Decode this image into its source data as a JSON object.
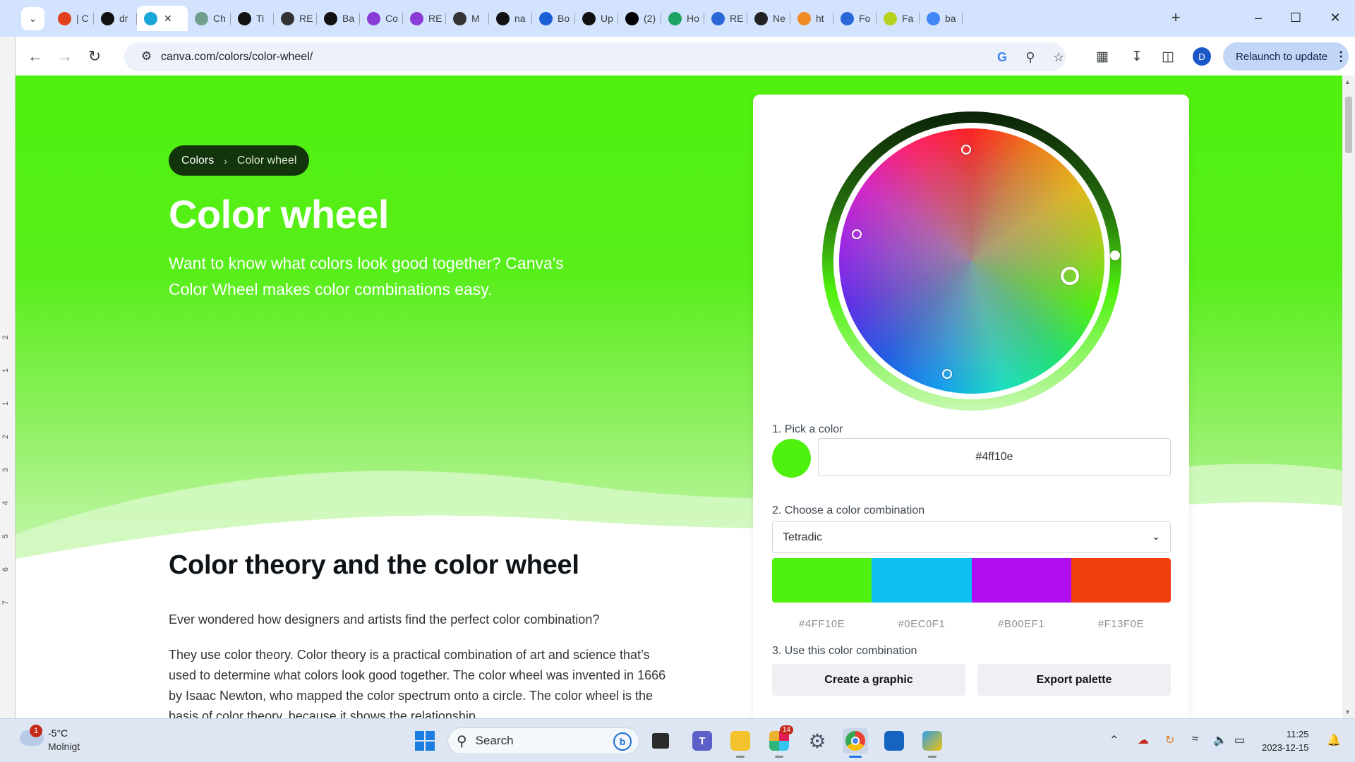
{
  "browser": {
    "tabs": [
      {
        "label": "| C",
        "icon": "opera-icon",
        "color": "#e0401a"
      },
      {
        "label": "dr",
        "icon": "github-icon",
        "color": "#111111"
      },
      {
        "label": "",
        "icon": "canva-icon",
        "color": "#1aa5d9",
        "active": true
      },
      {
        "label": "Ch",
        "icon": "chatgpt-icon",
        "color": "#6e9e8c"
      },
      {
        "label": "Ti",
        "icon": "github-icon",
        "color": "#111111"
      },
      {
        "label": "RE",
        "icon": "globe-icon",
        "color": "#333333"
      },
      {
        "label": "Ba",
        "icon": "github-icon",
        "color": "#111111"
      },
      {
        "label": "Co",
        "icon": "cube-icon",
        "color": "#8a3ad6"
      },
      {
        "label": "RE",
        "icon": "cube-icon",
        "color": "#8a3ad6"
      },
      {
        "label": "M",
        "icon": "markdown-icon",
        "color": "#333333"
      },
      {
        "label": "na",
        "icon": "github-icon",
        "color": "#111111"
      },
      {
        "label": "Bo",
        "icon": "link-icon",
        "color": "#1a5fd6"
      },
      {
        "label": "Up",
        "icon": "github-icon",
        "color": "#111111"
      },
      {
        "label": "(2)",
        "icon": "x-icon",
        "color": "#000000"
      },
      {
        "label": "Ho",
        "icon": "drive-icon",
        "color": "#1ea362"
      },
      {
        "label": "RE",
        "icon": "docs-icon",
        "color": "#2a68d8"
      },
      {
        "label": "Ne",
        "icon": "chatgpt-icon",
        "color": "#222222"
      },
      {
        "label": "ht",
        "icon": "fire-icon",
        "color": "#f08a24"
      },
      {
        "label": "Fo",
        "icon": "flag-icon",
        "color": "#2a68d8"
      },
      {
        "label": "Fa",
        "icon": "filezilla-icon",
        "color": "#b6d21c"
      },
      {
        "label": "ba",
        "icon": "google-icon",
        "color": "#4285f4"
      }
    ],
    "url": "canva.com/colors/color-wheel/",
    "relaunch_label": "Relaunch to update",
    "profile_initial": "D"
  },
  "page": {
    "breadcrumb": {
      "root": "Colors",
      "current": "Color wheel"
    },
    "title": "Color wheel",
    "subtitle": "Want to know what colors look good together? Canva's Color Wheel makes color combinations easy.",
    "section_title": "Color theory and the color wheel",
    "para1": "Ever wondered how designers and artists find the perfect color combination?",
    "para2": "They use color theory. Color theory is a practical combination of art and science that’s used to determine what colors look good together. The color wheel was invented in 1666 by Isaac Newton, who mapped the color spectrum onto a circle. The color wheel is the basis of color theory, because it shows the relationship"
  },
  "tool": {
    "step1": "1. Pick a color",
    "hex_value": "#4ff10e",
    "selected_color": "#4ff10e",
    "step2": "2. Choose a color combination",
    "combination": "Tetradic",
    "palette": [
      {
        "hex": "#4FF10E",
        "color": "#4ff10e"
      },
      {
        "hex": "#0EC0F1",
        "color": "#0ec0f1"
      },
      {
        "hex": "#B00EF1",
        "color": "#b00ef1"
      },
      {
        "hex": "#F13F0E",
        "color": "#f13f0e"
      }
    ],
    "step3": "3. Use this color combination",
    "create_label": "Create a graphic",
    "export_label": "Export palette"
  },
  "taskbar": {
    "weather_temp": "-5°C",
    "weather_cond": "Molnigt",
    "weather_badge": "1",
    "search_label": "Search",
    "slack_badge": "14",
    "time": "11:25",
    "date": "2023-12-15"
  },
  "ruler_numbers": [
    "2",
    "1",
    "1",
    "2",
    "3",
    "4",
    "5",
    "6",
    "7"
  ]
}
